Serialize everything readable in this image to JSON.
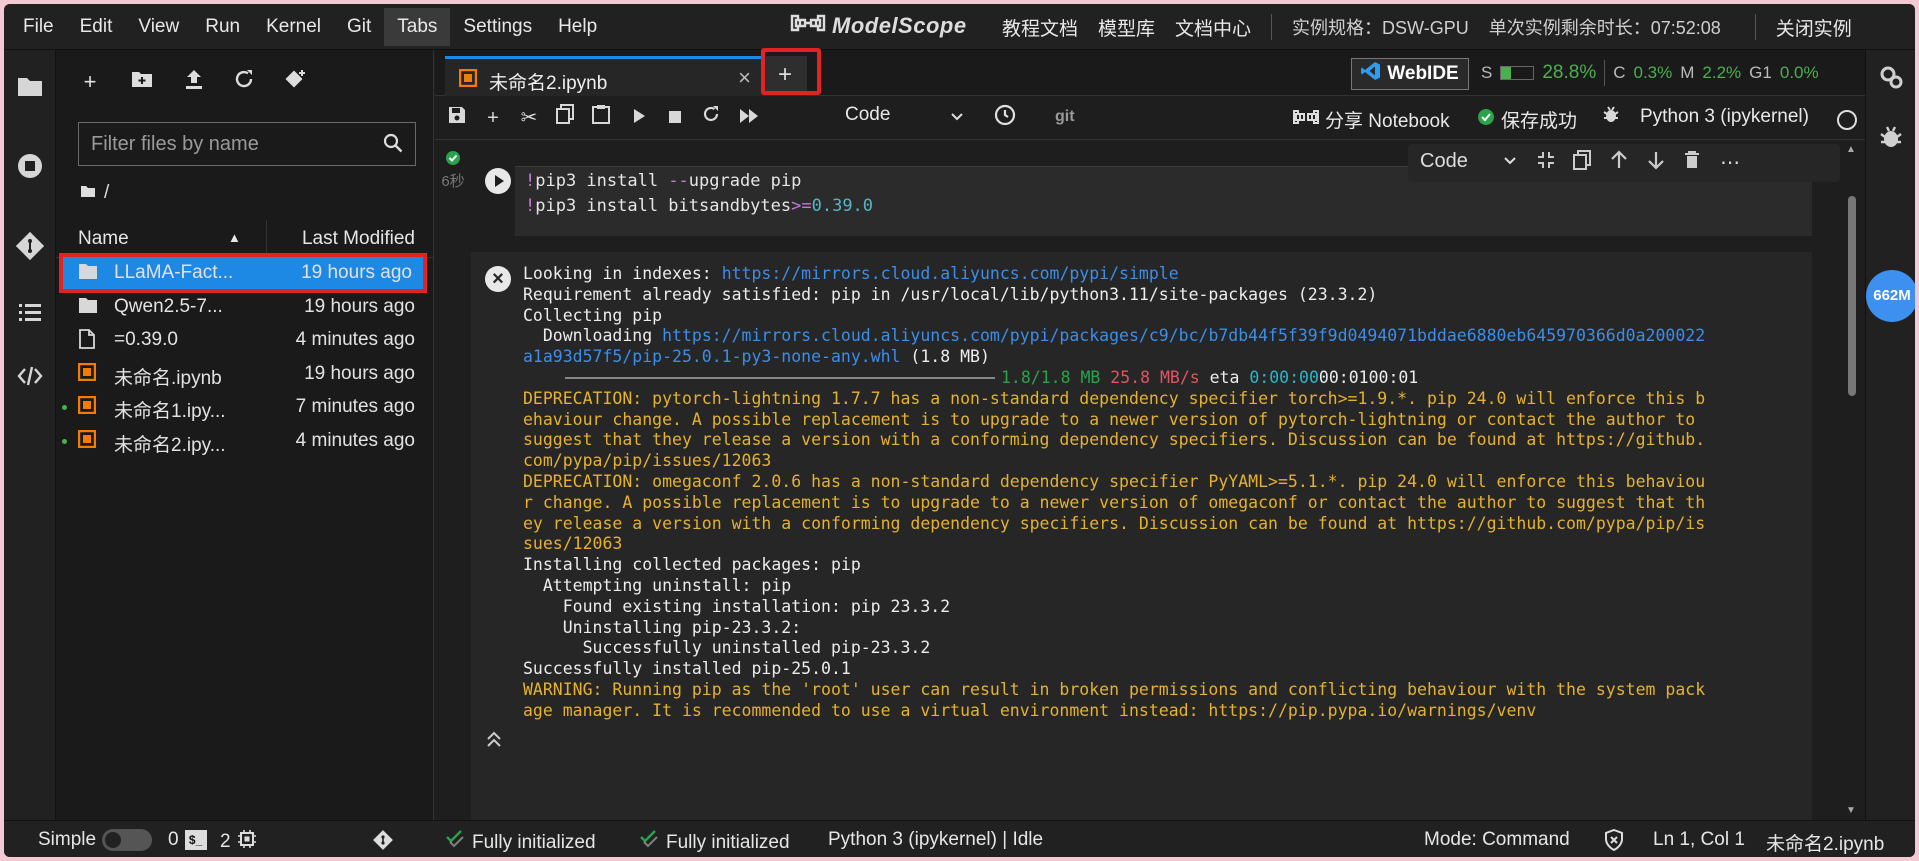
{
  "menubar": {
    "items": [
      "File",
      "Edit",
      "View",
      "Run",
      "Kernel",
      "Git",
      "Tabs",
      "Settings",
      "Help"
    ],
    "active": "Tabs",
    "brand": "ModelScope",
    "nav": [
      "教程文档",
      "模型库",
      "文档中心"
    ],
    "instance_spec": "实例规格：DSW-GPU",
    "time_left": "单次实例剩余时长：07:52:08",
    "close_instance": "关闭实例"
  },
  "filebrowser": {
    "filter_placeholder": "Filter files by name",
    "breadcrumb": "/",
    "col_name": "Name",
    "col_modified": "Last Modified",
    "files": [
      {
        "name": "LLaMA-Fact...",
        "modified": "19 hours ago",
        "icon": "folder-icon",
        "selected": true,
        "running": false
      },
      {
        "name": "Qwen2.5-7...",
        "modified": "19 hours ago",
        "icon": "folder-icon",
        "selected": false,
        "running": false
      },
      {
        "name": "=0.39.0",
        "modified": "4 minutes ago",
        "icon": "file-icon",
        "selected": false,
        "running": false
      },
      {
        "name": "未命名.ipynb",
        "modified": "19 hours ago",
        "icon": "notebook-icon",
        "selected": false,
        "running": false
      },
      {
        "name": "未命名1.ipy...",
        "modified": "7 minutes ago",
        "icon": "notebook-icon",
        "selected": false,
        "running": true
      },
      {
        "name": "未命名2.ipy...",
        "modified": "4 minutes ago",
        "icon": "notebook-icon",
        "selected": false,
        "running": true
      }
    ]
  },
  "tabs": {
    "active_tab": "未命名2.ipynb",
    "new_tab": "+",
    "webide": "WebIDE",
    "metrics": {
      "s_label": "S",
      "s_value": "28.8%",
      "s_fraction": 0.288,
      "c_label": "C",
      "c_value": "0.3%",
      "m_label": "M",
      "m_value": "2.2%",
      "g_label": "G1",
      "g_value": "0.0%"
    }
  },
  "toolbar": {
    "cell_type": "Code",
    "git": "git",
    "share": "分享 Notebook",
    "saved": "保存成功",
    "kernel": "Python 3 (ipykernel)"
  },
  "cell": {
    "exec_time": "6秒",
    "cell_type": "Code",
    "code_lines": [
      {
        "bang": "!",
        "text": "pip3 install ",
        "op": "--",
        "rest": "upgrade pip",
        "num": ""
      },
      {
        "bang": "!",
        "text": "pip3 install bitsandbytes",
        "op": ">=",
        "rest": "",
        "num": "0.39.0"
      }
    ],
    "output": {
      "l1_a": "Looking in indexes: ",
      "l1_url": "https://mirrors.cloud.aliyuncs.com/pypi/simple",
      "l2": "Requirement already satisfied: pip in /usr/local/lib/python3.11/site-packages (23.3.2)",
      "l3": "Collecting pip",
      "l4_a": "  Downloading ",
      "l4_url": "https://mirrors.cloud.aliyuncs.com/pypi/packages/c9/bc/b7db44f5f39f9d0494071bddae6880eb645970366d0a200022",
      "l5_url": "a1a93d57f5/pip-25.0.1-py3-none-any.whl",
      "l5_b": " (1.8 MB)",
      "l6_size": "1.8/1.8 MB",
      "l6_speed": "25.8 MB/s",
      "l6_eta": " eta ",
      "l6_time": "0:00:00",
      "l6_tail": "00:0100:01",
      "w1": "DEPRECATION: pytorch-lightning 1.7.7 has a non-standard dependency specifier torch>=1.9.*. pip 24.0 will enforce this b",
      "w2": "ehaviour change. A possible replacement is to upgrade to a newer version of pytorch-lightning or contact the author to",
      "w3": "suggest that they release a version with a conforming dependency specifiers. Discussion can be found at https://github.",
      "w4": "com/pypa/pip/issues/12063",
      "w5": "DEPRECATION: omegaconf 2.0.6 has a non-standard dependency specifier PyYAML>=5.1.*. pip 24.0 will enforce this behaviou",
      "w6": "r change. A possible replacement is to upgrade to a newer version of omegaconf or contact the author to suggest that th",
      "w7": "ey release a version with a conforming dependency specifiers. Discussion can be found at https://github.com/pypa/pip/is",
      "w8": "sues/12063",
      "i1": "Installing collected packages: pip",
      "i2": "  Attempting uninstall: pip",
      "i3": "    Found existing installation: pip 23.3.2",
      "i4": "    Uninstalling pip-23.3.2:",
      "i5": "      Successfully uninstalled pip-23.3.2",
      "i6": "Successfully installed pip-25.0.1",
      "x1": "WARNING: Running pip as the 'root' user can result in broken permissions and conflicting behaviour with the system pack",
      "x2": "age manager. It is recommended to use a virtual environment instead: https://pip.pypa.io/warnings/venv"
    }
  },
  "rightrail": {
    "memory": "662M"
  },
  "statusbar": {
    "simple": "Simple",
    "terminals": "0",
    "kernels": "2",
    "init1": "Fully initialized",
    "init2": "Fully initialized",
    "kernel_status": "Python 3 (ipykernel) | Idle",
    "mode": "Mode: Command",
    "position": "Ln 1, Col 1",
    "filename": "未命名2.ipynb"
  }
}
